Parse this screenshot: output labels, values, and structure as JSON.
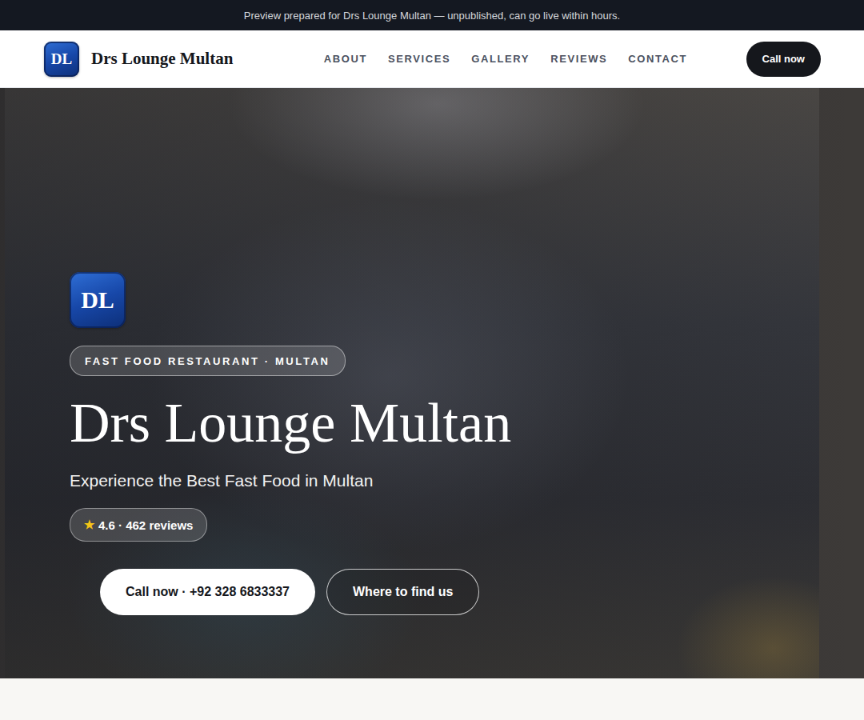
{
  "banner": "Preview prepared for Drs Lounge Multan — unpublished, can go live within hours.",
  "brand": {
    "logo": "DL",
    "name": "Drs Lounge Multan"
  },
  "nav": {
    "links": [
      "ABOUT",
      "SERVICES",
      "GALLERY",
      "REVIEWS",
      "CONTACT"
    ],
    "cta": "Call now"
  },
  "hero": {
    "logo": "DL",
    "tag": "FAST FOOD RESTAURANT · MULTAN",
    "title": "Drs Lounge Multan",
    "subtitle": "Experience the Best Fast Food in Multan",
    "rating": {
      "star": "★",
      "text": "4.6 · 462 reviews"
    },
    "buttons": [
      "Call now · +92 328 6833337",
      "Where to find us"
    ]
  }
}
